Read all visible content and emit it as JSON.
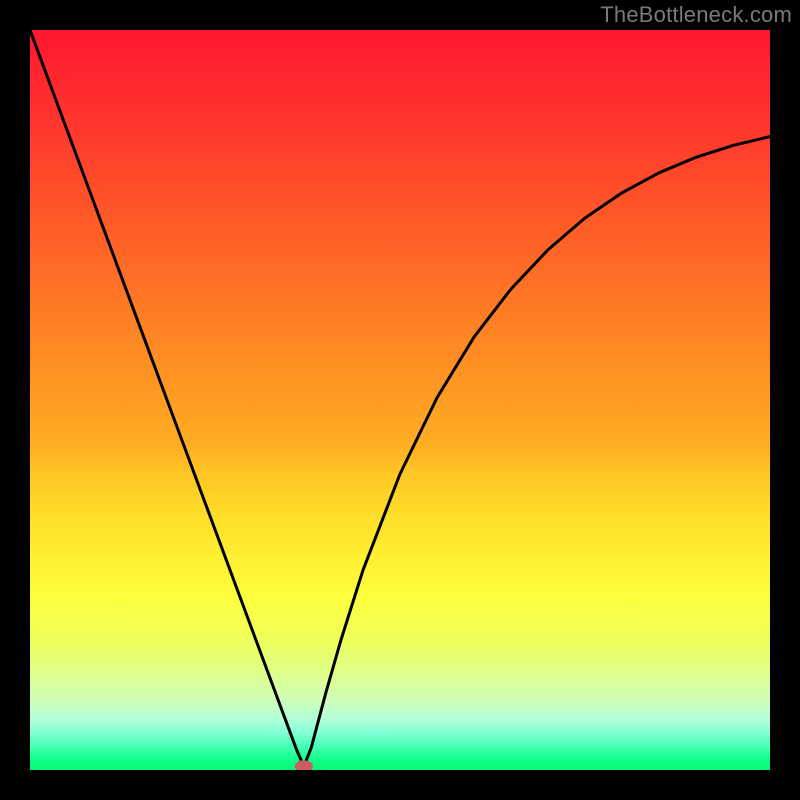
{
  "watermark": "TheBottleneck.com",
  "chart_data": {
    "type": "line",
    "title": "",
    "xlabel": "",
    "ylabel": "",
    "xlim": [
      0,
      100
    ],
    "ylim": [
      0,
      100
    ],
    "grid": false,
    "legend": false,
    "background": "rainbow-gradient",
    "series": [
      {
        "name": "bottleneck-curve",
        "x": [
          0,
          5,
          10,
          15,
          20,
          25,
          30,
          33,
          35,
          36,
          37,
          38,
          40,
          42,
          45,
          50,
          55,
          60,
          65,
          70,
          75,
          80,
          85,
          90,
          95,
          100
        ],
        "values": [
          100,
          86.5,
          73,
          59.5,
          46,
          32.5,
          19,
          10.9,
          5.5,
          2.8,
          0.5,
          3,
          10.5,
          17.5,
          27,
          40,
          50.3,
          58.5,
          65,
          70.3,
          74.6,
          78,
          80.7,
          82.8,
          84.4,
          85.6
        ]
      }
    ],
    "marker": {
      "name": "minimum-point",
      "x": 37,
      "y": 0.5,
      "color": "#cd5c5c"
    }
  }
}
